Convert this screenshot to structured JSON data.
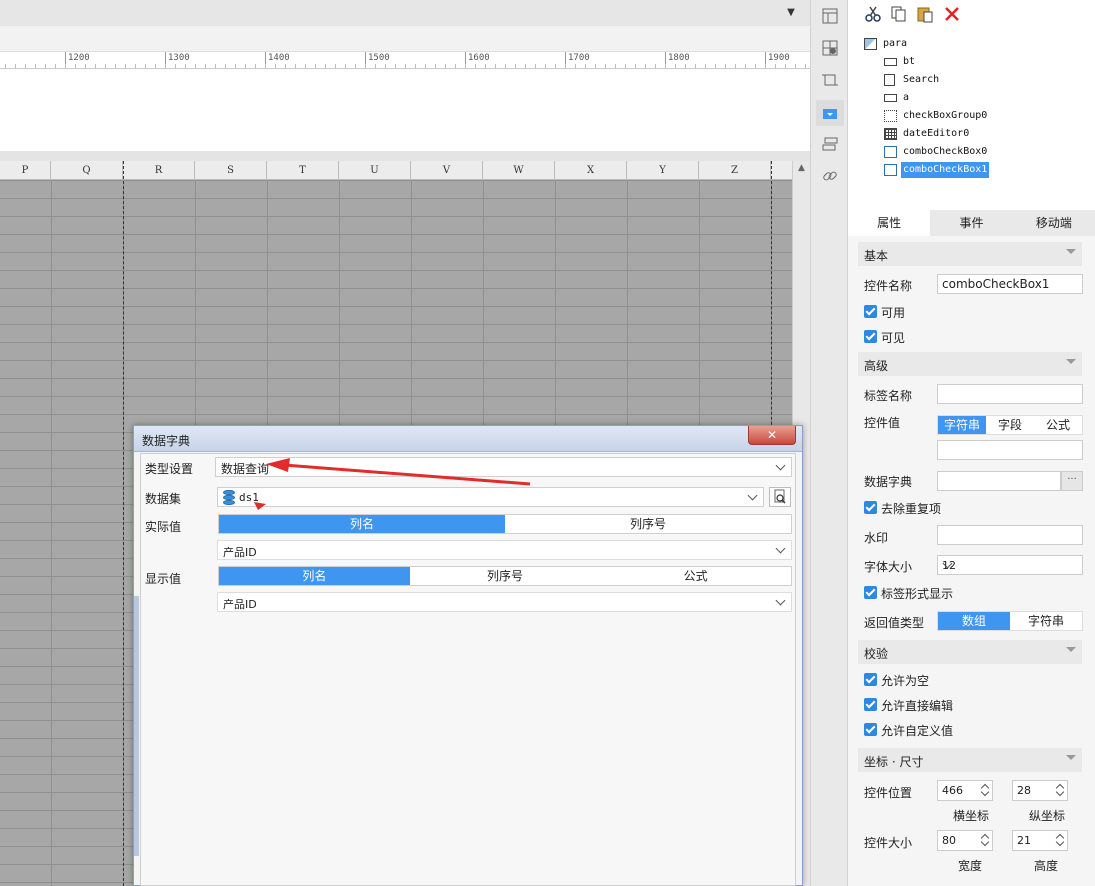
{
  "ruler": {
    "labels": [
      "1200",
      "1300",
      "1400",
      "1500",
      "1600",
      "1700",
      "1800",
      "1900"
    ]
  },
  "sheet": {
    "columns": [
      "P",
      "Q",
      "R",
      "S",
      "T",
      "U",
      "V",
      "W",
      "X",
      "Y",
      "Z"
    ]
  },
  "dialog": {
    "title": "数据字典",
    "close": "✕",
    "type_label": "类型设置",
    "type_value": "数据查询",
    "dataset_label": "数据集",
    "dataset_value": "ds1",
    "actual_label": "实际值",
    "actual_tabs": [
      "列名",
      "列序号"
    ],
    "actual_value": "产品ID",
    "display_label": "显示值",
    "display_tabs": [
      "列名",
      "列序号",
      "公式"
    ],
    "display_value": "产品ID"
  },
  "tree": {
    "nodes": [
      "para",
      "bt",
      "Search",
      "a",
      "checkBoxGroup0",
      "dateEditor0",
      "comboCheckBox0",
      "comboCheckBox1"
    ]
  },
  "tabs": [
    "属性",
    "事件",
    "移动端"
  ],
  "props": {
    "basic_title": "基本",
    "name_label": "控件名称",
    "name_value": "comboCheckBox1",
    "enabled": "可用",
    "visible": "可见",
    "advanced_title": "高级",
    "tag_label": "标签名称",
    "value_label": "控件值",
    "value_tabs": [
      "字符串",
      "字段",
      "公式"
    ],
    "dict_label": "数据字典",
    "dict_btn": "···",
    "dedupe": "去除重复项",
    "watermark_label": "水印",
    "font_label": "字体大小",
    "font_value": "12",
    "tagstyle": "标签形式显示",
    "return_label": "返回值类型",
    "return_tabs": [
      "数组",
      "字符串"
    ],
    "validate_title": "校验",
    "allow_empty": "允许为空",
    "allow_edit": "允许直接编辑",
    "allow_custom": "允许自定义值",
    "coord_title": "坐标 · 尺寸",
    "pos_label": "控件位置",
    "pos_x": "466",
    "pos_y": "28",
    "x_lbl": "横坐标",
    "y_lbl": "纵坐标",
    "size_label": "控件大小",
    "width": "80",
    "height": "21",
    "w_lbl": "宽度",
    "h_lbl": "高度"
  },
  "colors": {
    "accent": "#3f96f0",
    "annotation": "#e32b2b"
  }
}
